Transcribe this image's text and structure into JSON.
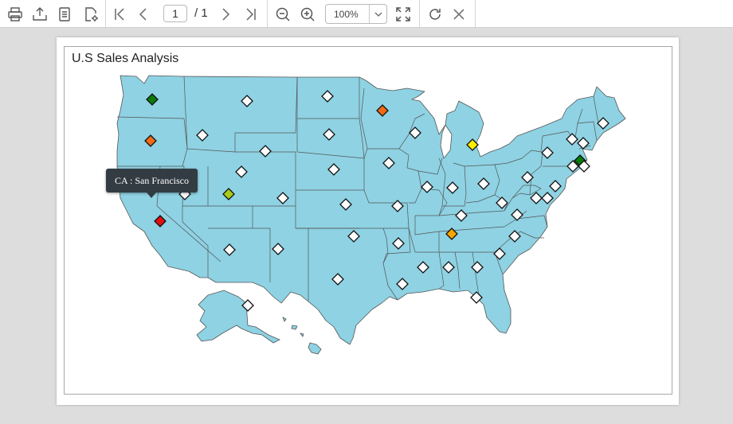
{
  "toolbar": {
    "current_page": "1",
    "page_total": "/ 1",
    "zoom": "100%"
  },
  "report": {
    "title": "U.S Sales Analysis",
    "map_fill": "#8ed2e3",
    "map_stroke": "#555555",
    "tooltip": "CA : San Francisco"
  },
  "colors": {
    "green": "#0a7a0a",
    "orange_red": "#f26a16",
    "red": "#e01010",
    "yellow_green": "#a8cc1a",
    "yellow": "#ffee00",
    "orange": "#f7a500",
    "white": "#ffffff"
  },
  "markers": [
    {
      "state": "WA",
      "color": "green"
    },
    {
      "state": "OR",
      "color": "orange_red"
    },
    {
      "state": "CA",
      "color": "red"
    },
    {
      "state": "NV",
      "color": "white"
    },
    {
      "state": "ID",
      "color": "white"
    },
    {
      "state": "MT",
      "color": "white"
    },
    {
      "state": "WY",
      "color": "white"
    },
    {
      "state": "UT",
      "color": "yellow_green"
    },
    {
      "state": "UT2",
      "color": "white"
    },
    {
      "state": "CO",
      "color": "white"
    },
    {
      "state": "AZ",
      "color": "white"
    },
    {
      "state": "NM",
      "color": "white"
    },
    {
      "state": "ND",
      "color": "white"
    },
    {
      "state": "SD",
      "color": "white"
    },
    {
      "state": "NE",
      "color": "white"
    },
    {
      "state": "KS",
      "color": "white"
    },
    {
      "state": "OK",
      "color": "white"
    },
    {
      "state": "TX",
      "color": "white"
    },
    {
      "state": "MN",
      "color": "orange_red"
    },
    {
      "state": "IA",
      "color": "white"
    },
    {
      "state": "MO",
      "color": "white"
    },
    {
      "state": "AR",
      "color": "white"
    },
    {
      "state": "LA",
      "color": "white"
    },
    {
      "state": "WI",
      "color": "white"
    },
    {
      "state": "IL",
      "color": "white"
    },
    {
      "state": "MI",
      "color": "yellow"
    },
    {
      "state": "IN",
      "color": "white"
    },
    {
      "state": "OH",
      "color": "white"
    },
    {
      "state": "KY",
      "color": "white"
    },
    {
      "state": "TN",
      "color": "orange"
    },
    {
      "state": "MS",
      "color": "white"
    },
    {
      "state": "AL",
      "color": "white"
    },
    {
      "state": "GA",
      "color": "white"
    },
    {
      "state": "FL",
      "color": "white"
    },
    {
      "state": "SC",
      "color": "white"
    },
    {
      "state": "NC",
      "color": "white"
    },
    {
      "state": "VA",
      "color": "white"
    },
    {
      "state": "WV",
      "color": "white"
    },
    {
      "state": "PA",
      "color": "white"
    },
    {
      "state": "NY",
      "color": "white"
    },
    {
      "state": "MD",
      "color": "white"
    },
    {
      "state": "DE",
      "color": "white"
    },
    {
      "state": "NJ",
      "color": "white"
    },
    {
      "state": "CT",
      "color": "white"
    },
    {
      "state": "MA",
      "color": "green"
    },
    {
      "state": "RI",
      "color": "white"
    },
    {
      "state": "VT",
      "color": "white"
    },
    {
      "state": "NH",
      "color": "white"
    },
    {
      "state": "ME",
      "color": "white"
    },
    {
      "state": "AK",
      "color": "white"
    }
  ]
}
